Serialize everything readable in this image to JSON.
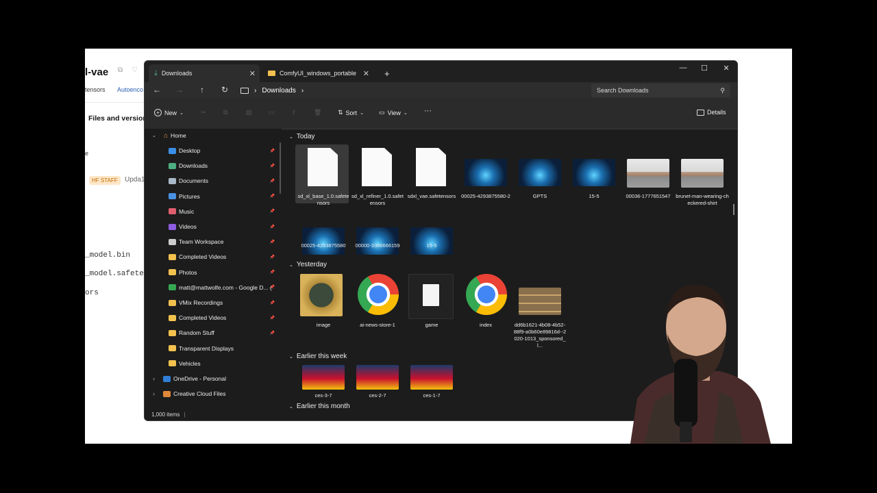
{
  "background_page": {
    "repo_title": "l-vae",
    "tag_safetensors": "tensors",
    "tag_autoencoder": "Autoenco",
    "tab_files": "Files and version",
    "row_text": "e",
    "hf_staff_badge": "HF STAFF",
    "update_text": "Upda1",
    "file_1": "_model.bin",
    "file_2": "_model.safetenso",
    "file_3": "ors"
  },
  "window": {
    "tabs": [
      {
        "label": "Downloads",
        "icon": "download-icon"
      },
      {
        "label": "ComfyUI_windows_portable",
        "icon": "folder-icon"
      }
    ],
    "new_tab_symbol": "+",
    "controls": {
      "minimize": "—",
      "maximize": "☐",
      "close": "✕"
    }
  },
  "address": {
    "breadcrumb": "Downloads",
    "search_placeholder": "Search Downloads"
  },
  "commands": {
    "new_label": "New",
    "sort_label": "Sort",
    "view_label": "View",
    "more_label": "···",
    "details_label": "Details"
  },
  "sidebar": {
    "home": "Home",
    "items": [
      {
        "label": "Desktop",
        "color": "#3a8ee6"
      },
      {
        "label": "Downloads",
        "color": "#4caf82"
      },
      {
        "label": "Documents",
        "color": "#a9b8c8"
      },
      {
        "label": "Pictures",
        "color": "#4a90e2"
      },
      {
        "label": "Music",
        "color": "#e05d6f"
      },
      {
        "label": "Videos",
        "color": "#8e5ce0"
      },
      {
        "label": "Team Workspace",
        "color": "#cccccc"
      },
      {
        "label": "Completed Videos",
        "color": "#f2c14e"
      },
      {
        "label": "Photos",
        "color": "#f2c14e"
      },
      {
        "label": "matt@mattwolfe.com - Google D... (",
        "color": "#34a853"
      },
      {
        "label": "VMix Recordings",
        "color": "#f2c14e"
      },
      {
        "label": "Completed Videos",
        "color": "#f2c14e"
      },
      {
        "label": "Random Stuff",
        "color": "#f2c14e"
      },
      {
        "label": "Transparent Displays",
        "color": "#f2c14e"
      },
      {
        "label": "Vehicles",
        "color": "#f2c14e"
      },
      {
        "label": "OneDrive - Personal",
        "color": "#2f7fd8"
      },
      {
        "label": "Creative Cloud Files",
        "color": "#e0883a"
      }
    ]
  },
  "groups": {
    "today": "Today",
    "yesterday": "Yesterday",
    "earlier_week": "Earlier this week",
    "earlier_month": "Earlier this month"
  },
  "files_today": [
    {
      "name": "sd_xl_base_1.0.safetensors",
      "kind": "doc"
    },
    {
      "name": "sd_xl_refiner_1.0.safetensors",
      "kind": "doc"
    },
    {
      "name": "sdxl_vae.safetensors",
      "kind": "doc"
    },
    {
      "name": "00025-4293875580-2",
      "kind": "image"
    },
    {
      "name": "GPTS",
      "kind": "image"
    },
    {
      "name": "15-5",
      "kind": "image"
    },
    {
      "name": "00036-1777651547",
      "kind": "person"
    },
    {
      "name": "brunet-man-wearing-checkered-shirt",
      "kind": "person"
    },
    {
      "name": "00025-4293875580",
      "kind": "image"
    },
    {
      "name": "00000-3386666159",
      "kind": "image"
    },
    {
      "name": "15-5",
      "kind": "image"
    }
  ],
  "files_yesterday": [
    {
      "name": "image",
      "kind": "painting"
    },
    {
      "name": "ai-news-store-1",
      "kind": "chrome"
    },
    {
      "name": "game",
      "kind": "script"
    },
    {
      "name": "index",
      "kind": "chrome"
    },
    {
      "name": "dd6b1621-4b08-4b52-88f9-a0b60e89816d--2020-1013_sponsored_l...",
      "kind": "shelf"
    }
  ],
  "files_week": [
    {
      "name": "ces-3-7",
      "kind": "thumb"
    },
    {
      "name": "ces-2-7",
      "kind": "thumb"
    },
    {
      "name": "ces-1-7",
      "kind": "thumb"
    }
  ],
  "status": {
    "count": "1,000 items"
  }
}
